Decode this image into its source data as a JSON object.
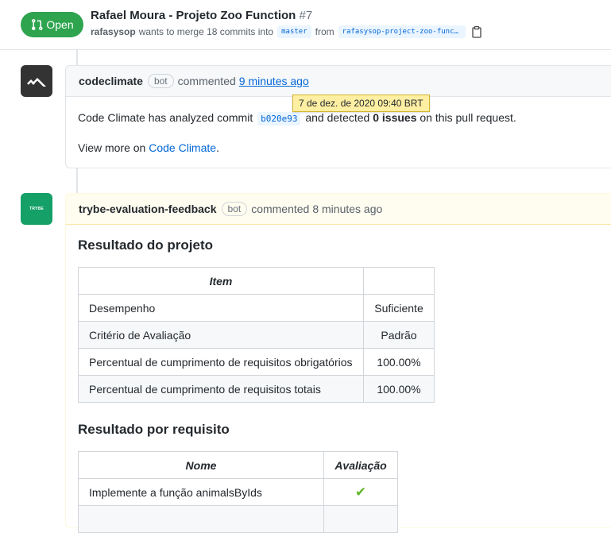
{
  "pr": {
    "status": "Open",
    "title": "Rafael Moura - Projeto Zoo Function",
    "number": "#7",
    "author": "rafasysop",
    "merge_text": "wants to merge 18 commits into",
    "base_branch": "master",
    "from_text": "from",
    "head_branch": "rafasysop-project-zoo-function",
    "copy_icon": "clipboard-icon"
  },
  "comments": [
    {
      "author": "codeclimate",
      "badge": "bot",
      "action": "commented",
      "time": "9 minutes ago",
      "tooltip": "7 de dez. de 2020 09:40 BRT",
      "body_pre": "Code Climate has analyzed commit",
      "commit": "b020e93",
      "body_mid": "and detected",
      "issues": "0 issues",
      "body_post": "on this pull request.",
      "view_more": "View more on",
      "link": "Code Climate",
      "link_suffix": "."
    },
    {
      "author": "trybe-evaluation-feedback",
      "badge": "bot",
      "action": "commented",
      "time": "8 minutes ago",
      "avatar_text": "TRYBE",
      "section1": {
        "title": "Resultado do projeto",
        "headers": [
          "Item",
          ""
        ],
        "rows": [
          [
            "Desempenho",
            "Suficiente"
          ],
          [
            "Critério de Avaliação",
            "Padrão"
          ],
          [
            "Percentual de cumprimento de requisitos obrigatórios",
            "100.00%"
          ],
          [
            "Percentual de cumprimento de requisitos totais",
            "100.00%"
          ]
        ]
      },
      "section2": {
        "title": "Resultado por requisito",
        "headers": [
          "Nome",
          "Avaliação"
        ],
        "rows": [
          [
            "Implemente a função animalsByIds",
            "✔"
          ]
        ]
      }
    }
  ],
  "colors": {
    "open_green": "#2ea44f",
    "link_blue": "#0366d6",
    "check_green": "#61b82e",
    "tooltip_bg": "#ffefa3"
  }
}
